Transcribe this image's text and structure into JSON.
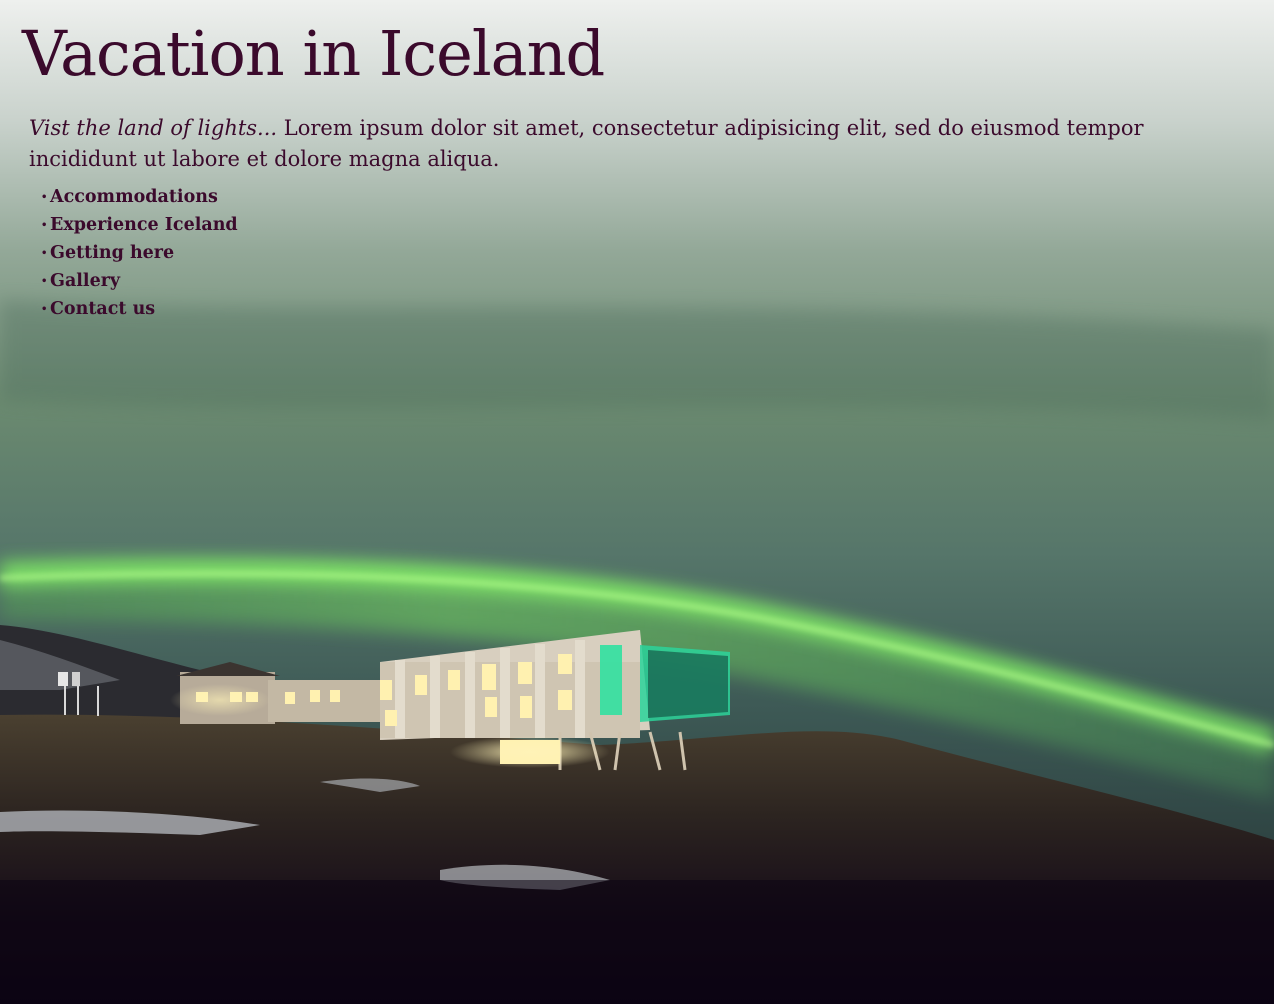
{
  "page": {
    "title": "Vacation in Iceland",
    "intro_lead": "Vist the land of lights...",
    "intro_text": "Lorem ipsum dolor sit amet, consectetur adipisicing elit, sed do eiusmod tempor incididunt ut labore et dolore magna aliqua."
  },
  "nav": {
    "items": [
      {
        "label": "Accommodations"
      },
      {
        "label": "Experience Iceland"
      },
      {
        "label": "Getting here"
      },
      {
        "label": "Gallery"
      },
      {
        "label": "Contact us"
      }
    ],
    "bullet": "•"
  },
  "colors": {
    "text": "#3b0a2c",
    "sky_top": "#eef0ee",
    "aurora": "#6fe05a",
    "ground": "#120818"
  },
  "background": {
    "description_icon": "aurora-hotel-photo"
  }
}
